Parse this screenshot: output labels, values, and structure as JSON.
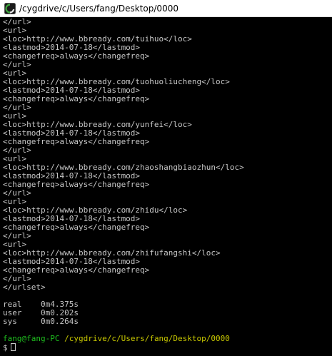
{
  "window": {
    "title": "/cygdrive/c/Users/fang/Desktop/0000",
    "icon": "cygwin-terminal-icon"
  },
  "output": [
    "</url>",
    "<url>",
    "<loc>http://www.bbready.com/tuihuo</loc>",
    "<lastmod>2014-07-18</lastmod>",
    "<changefreq>always</changefreq>",
    "</url>",
    "<url>",
    "<loc>http://www.bbready.com/tuohuoliucheng</loc>",
    "<lastmod>2014-07-18</lastmod>",
    "<changefreq>always</changefreq>",
    "</url>",
    "<url>",
    "<loc>http://www.bbready.com/yunfei</loc>",
    "<lastmod>2014-07-18</lastmod>",
    "<changefreq>always</changefreq>",
    "</url>",
    "<url>",
    "<loc>http://www.bbready.com/zhaoshangbiaozhun</loc>",
    "<lastmod>2014-07-18</lastmod>",
    "<changefreq>always</changefreq>",
    "</url>",
    "<url>",
    "<loc>http://www.bbready.com/zhidu</loc>",
    "<lastmod>2014-07-18</lastmod>",
    "<changefreq>always</changefreq>",
    "</url>",
    "<url>",
    "<loc>http://www.bbready.com/zhifufangshi</loc>",
    "<lastmod>2014-07-18</lastmod>",
    "<changefreq>always</changefreq>",
    "</url>",
    "</urlset>"
  ],
  "timing": [
    "real    0m4.375s",
    "user    0m0.202s",
    "sys     0m0.264s"
  ],
  "prompt": {
    "user_host": "fang@fang-PC",
    "path": "/cygdrive/c/Users/fang/Desktop/0000",
    "symbol": "$"
  },
  "colors": {
    "background": "#000000",
    "text": "#c7c7c7",
    "prompt_user": "#1fbf1f",
    "prompt_path": "#c8c800"
  }
}
